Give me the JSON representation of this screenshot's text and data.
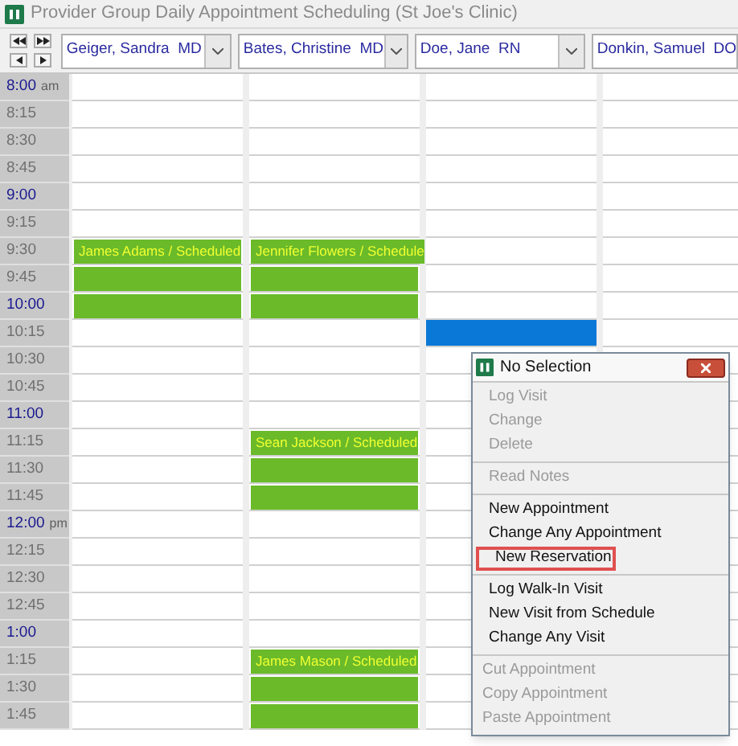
{
  "window": {
    "title": "Provider Group Daily Appointment Scheduling (St Joe's Clinic)"
  },
  "times": [
    {
      "time": "8:00",
      "suffix": "am",
      "kind": "hour"
    },
    {
      "time": "8:15",
      "kind": "quarter"
    },
    {
      "time": "8:30",
      "kind": "quarter"
    },
    {
      "time": "8:45",
      "kind": "quarter"
    },
    {
      "time": "9:00",
      "kind": "hour"
    },
    {
      "time": "9:15",
      "kind": "quarter"
    },
    {
      "time": "9:30",
      "kind": "quarter"
    },
    {
      "time": "9:45",
      "kind": "quarter"
    },
    {
      "time": "10:00",
      "kind": "hour"
    },
    {
      "time": "10:15",
      "kind": "quarter"
    },
    {
      "time": "10:30",
      "kind": "quarter"
    },
    {
      "time": "10:45",
      "kind": "quarter"
    },
    {
      "time": "11:00",
      "kind": "hour"
    },
    {
      "time": "11:15",
      "kind": "quarter"
    },
    {
      "time": "11:30",
      "kind": "quarter"
    },
    {
      "time": "11:45",
      "kind": "quarter"
    },
    {
      "time": "12:00",
      "suffix": "pm",
      "kind": "hour"
    },
    {
      "time": "12:15",
      "kind": "quarter"
    },
    {
      "time": "12:30",
      "kind": "quarter"
    },
    {
      "time": "12:45",
      "kind": "quarter"
    },
    {
      "time": "1:00",
      "kind": "hour"
    },
    {
      "time": "1:15",
      "kind": "quarter"
    },
    {
      "time": "1:30",
      "kind": "quarter"
    },
    {
      "time": "1:45",
      "kind": "quarter"
    }
  ],
  "providers": [
    {
      "name": "Geiger, Sandra  MD",
      "slots": [
        {
          "kind": "free"
        },
        {
          "kind": "free"
        },
        {
          "kind": "free"
        },
        {
          "kind": "free"
        },
        {
          "kind": "free"
        },
        {
          "kind": "free"
        },
        {
          "kind": "booked",
          "label": "James Adams / Scheduled"
        },
        {
          "kind": "booked"
        },
        {
          "kind": "booked"
        },
        {
          "kind": "free"
        },
        {
          "kind": "free"
        },
        {
          "kind": "free"
        },
        {
          "kind": "free"
        },
        {
          "kind": "free"
        },
        {
          "kind": "free"
        },
        {
          "kind": "free"
        },
        {
          "kind": "free"
        },
        {
          "kind": "free"
        },
        {
          "kind": "free"
        },
        {
          "kind": "free"
        },
        {
          "kind": "free"
        },
        {
          "kind": "free"
        },
        {
          "kind": "free"
        },
        {
          "kind": "free"
        }
      ]
    },
    {
      "name": "Bates, Christine  MD",
      "slots": [
        {
          "kind": "free"
        },
        {
          "kind": "free"
        },
        {
          "kind": "free"
        },
        {
          "kind": "free"
        },
        {
          "kind": "free"
        },
        {
          "kind": "free"
        },
        {
          "kind": "booked",
          "label": "Jennifer Flowers / Schedule"
        },
        {
          "kind": "booked"
        },
        {
          "kind": "booked"
        },
        {
          "kind": "free"
        },
        {
          "kind": "free"
        },
        {
          "kind": "free"
        },
        {
          "kind": "free"
        },
        {
          "kind": "booked",
          "label": "Sean Jackson / Scheduled"
        },
        {
          "kind": "booked"
        },
        {
          "kind": "booked"
        },
        {
          "kind": "free"
        },
        {
          "kind": "free"
        },
        {
          "kind": "free"
        },
        {
          "kind": "free"
        },
        {
          "kind": "free"
        },
        {
          "kind": "booked",
          "label": "James Mason / Scheduled"
        },
        {
          "kind": "booked"
        },
        {
          "kind": "booked"
        }
      ]
    },
    {
      "name": "Doe, Jane  RN",
      "slots": [
        {
          "kind": "free"
        },
        {
          "kind": "free"
        },
        {
          "kind": "free"
        },
        {
          "kind": "free"
        },
        {
          "kind": "free"
        },
        {
          "kind": "free"
        },
        {
          "kind": "free"
        },
        {
          "kind": "free"
        },
        {
          "kind": "free"
        },
        {
          "kind": "selected"
        },
        {
          "kind": "free"
        },
        {
          "kind": "free"
        },
        {
          "kind": "free"
        },
        {
          "kind": "free"
        },
        {
          "kind": "free"
        },
        {
          "kind": "free"
        },
        {
          "kind": "free"
        },
        {
          "kind": "free"
        },
        {
          "kind": "free"
        },
        {
          "kind": "free"
        },
        {
          "kind": "free"
        },
        {
          "kind": "free"
        },
        {
          "kind": "free"
        },
        {
          "kind": "free"
        }
      ]
    },
    {
      "name": "Donkin, Samuel  DO",
      "slots": [
        {
          "kind": "free"
        },
        {
          "kind": "free"
        },
        {
          "kind": "free"
        },
        {
          "kind": "free"
        },
        {
          "kind": "free"
        },
        {
          "kind": "free"
        },
        {
          "kind": "free"
        },
        {
          "kind": "free"
        },
        {
          "kind": "free"
        },
        {
          "kind": "free"
        },
        {
          "kind": "free"
        },
        {
          "kind": "free"
        },
        {
          "kind": "free"
        },
        {
          "kind": "free"
        },
        {
          "kind": "free"
        },
        {
          "kind": "free"
        },
        {
          "kind": "free"
        },
        {
          "kind": "free"
        },
        {
          "kind": "free"
        },
        {
          "kind": "free"
        },
        {
          "kind": "free"
        },
        {
          "kind": "free"
        },
        {
          "kind": "free"
        },
        {
          "kind": "free"
        }
      ]
    }
  ],
  "context_menu": {
    "title": "No Selection",
    "groups": [
      [
        {
          "label": "Log Visit",
          "disabled": true,
          "highlighted": false
        },
        {
          "label": "Change",
          "disabled": true,
          "highlighted": false
        },
        {
          "label": "Delete",
          "disabled": true,
          "highlighted": false
        }
      ],
      [
        {
          "label": "Read Notes",
          "disabled": true,
          "highlighted": false
        }
      ],
      [
        {
          "label": "New Appointment",
          "disabled": false,
          "highlighted": false
        },
        {
          "label": "Change Any Appointment",
          "disabled": false,
          "highlighted": false
        },
        {
          "label": "New Reservation",
          "disabled": false,
          "highlighted": true
        }
      ],
      [
        {
          "label": "Log Walk-In Visit",
          "disabled": false,
          "highlighted": false
        },
        {
          "label": "New Visit from Schedule",
          "disabled": false,
          "highlighted": false
        },
        {
          "label": "Change Any Visit",
          "disabled": false,
          "highlighted": false
        }
      ],
      [
        {
          "label": "Cut Appointment",
          "disabled": true,
          "highlighted": false
        },
        {
          "label": "Copy Appointment",
          "disabled": true,
          "highlighted": false
        },
        {
          "label": "Paste Appointment",
          "disabled": true,
          "highlighted": false
        }
      ]
    ]
  }
}
